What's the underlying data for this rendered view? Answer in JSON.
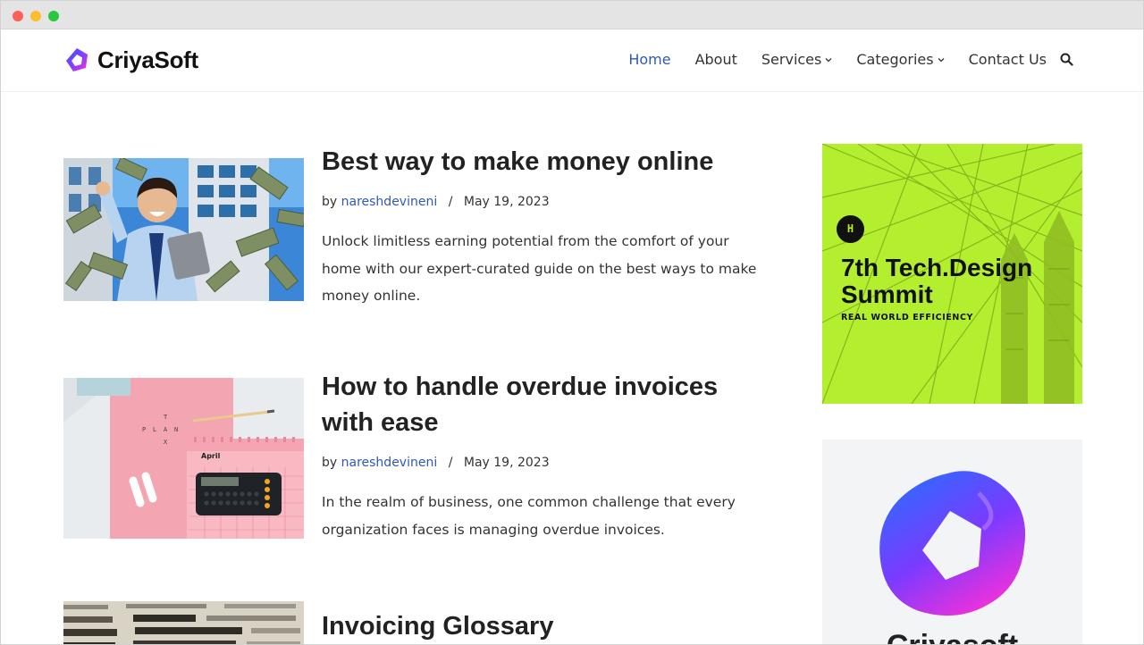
{
  "brand": {
    "name": "CriyaSoft",
    "accent": "#2f5aae"
  },
  "nav": {
    "items": [
      {
        "label": "Home",
        "active": true,
        "dropdown": false
      },
      {
        "label": "About",
        "active": false,
        "dropdown": false
      },
      {
        "label": "Services",
        "active": false,
        "dropdown": true
      },
      {
        "label": "Categories",
        "active": false,
        "dropdown": true
      },
      {
        "label": "Contact Us",
        "active": false,
        "dropdown": false
      }
    ],
    "search_icon": "search-icon"
  },
  "posts": [
    {
      "title": "Best way to make money online",
      "by": "by",
      "author": "nareshdevineni",
      "separator": "/",
      "date": "May 19, 2023",
      "excerpt": "Unlock limitless earning potential from the comfort of your home with our expert-curated guide on the best ways to make money online."
    },
    {
      "title": "How to handle overdue invoices with ease",
      "by": "by",
      "author": "nareshdevineni",
      "separator": "/",
      "date": "May 19, 2023",
      "excerpt": "In the realm of business, one common challenge that every organization faces is managing overdue invoices."
    },
    {
      "title": "Invoicing Glossary"
    }
  ],
  "sidebar": {
    "ad1": {
      "badge": "H",
      "title": "7th Tech.Design Summit",
      "subtitle": "REAL WORLD EFFICIENCY",
      "color": "#b4ef2f"
    },
    "ad2": {
      "text": "Criyasoft"
    }
  }
}
